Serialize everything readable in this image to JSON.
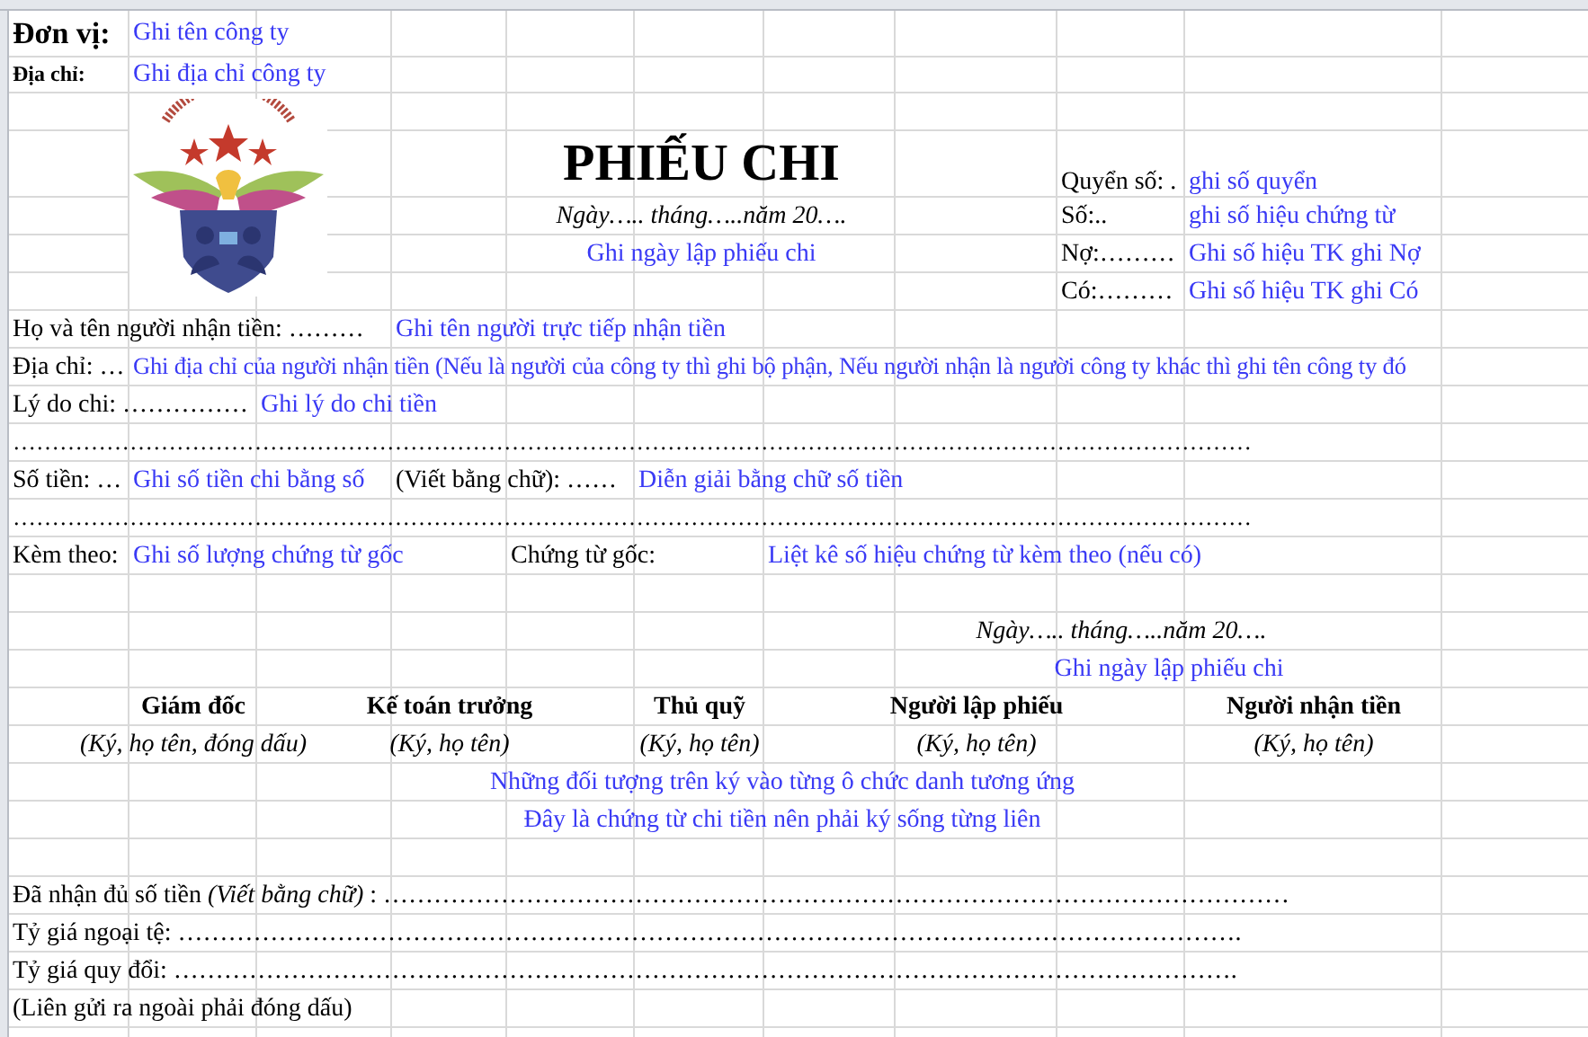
{
  "unit": {
    "label": "Đơn vị:",
    "value": "Ghi tên công ty"
  },
  "address": {
    "label": "Địa chỉ:",
    "value": "Ghi địa chỉ công ty"
  },
  "title": "PHIẾU CHI",
  "date": "Ngày….. tháng…..năm 20….",
  "date_hint": "Ghi ngày lập phiếu chi",
  "book": [
    {
      "label": "Quyển số: .",
      "value": "ghi số quyển"
    },
    {
      "label": "Số:..",
      "value": "ghi số hiệu chứng từ"
    },
    {
      "label": "Nợ:………",
      "value": "Ghi số hiệu TK ghi Nợ"
    },
    {
      "label": "Có:………",
      "value": "Ghi số hiệu TK ghi Có"
    }
  ],
  "payee_name": {
    "label": "Họ và tên người nhận tiền: ………",
    "value": "Ghi tên người trực tiếp nhận tiền"
  },
  "payee_address": {
    "label": "Địa chỉ: …",
    "value": "Ghi địa chỉ của người nhận tiền (Nếu là người của công ty thì ghi bộ phận, Nếu người nhận là người công ty khác thì ghi tên công ty đó"
  },
  "reason": {
    "label": "Lý do chi: ……………",
    "value": "Ghi lý do chi tiền"
  },
  "dots_line_1": "……………………………………………………………………………………………………………………………………………",
  "amount": {
    "label": "Số tiền: …",
    "value": "Ghi số tiền chi bằng số",
    "words_label": "(Viết bằng chữ): ……",
    "words_value": "Diễn giải bằng chữ số tiền"
  },
  "dots_line_2": "……………………………………………………………………………………………………………………………………………",
  "attachments": {
    "label": "Kèm theo:",
    "value": "Ghi số lượng chứng từ gốc",
    "originals_label": "Chứng từ gốc:",
    "originals_value": "Liệt kê số hiệu chứng từ kèm theo (nếu có)"
  },
  "sign_date": "Ngày….. tháng…..năm 20….",
  "sign_date_hint": "Ghi ngày lập phiếu chi",
  "signatories": [
    {
      "title": "Giám đốc",
      "note": "(Ký, họ tên, đóng dấu)"
    },
    {
      "title": "Kế toán trưởng",
      "note": "(Ký, họ tên)"
    },
    {
      "title": "Thủ quỹ",
      "note": "(Ký, họ tên)"
    },
    {
      "title": "Người lập phiếu",
      "note": "(Ký, họ tên)"
    },
    {
      "title": "Người nhận tiền",
      "note": "(Ký, họ tên)"
    }
  ],
  "sign_notes": [
    "Những đối tượng trên ký vào từng ô chức danh tương ứng",
    "Đây là chứng từ chi tiền nên phải ký sống từng liên"
  ],
  "footer_lines": [
    "Đã nhận đủ số tiền *(Viết bằng chữ)* : ………………………………………………………………………………………………",
    "Tỷ giá ngoại tệ: ……………………………………………………………………………………………………………….",
    "Tỷ giá quy đổi: ……………………………………………………………………………………………………………….",
    "(Liên gửi ra ngoài phải đóng dấu)"
  ]
}
